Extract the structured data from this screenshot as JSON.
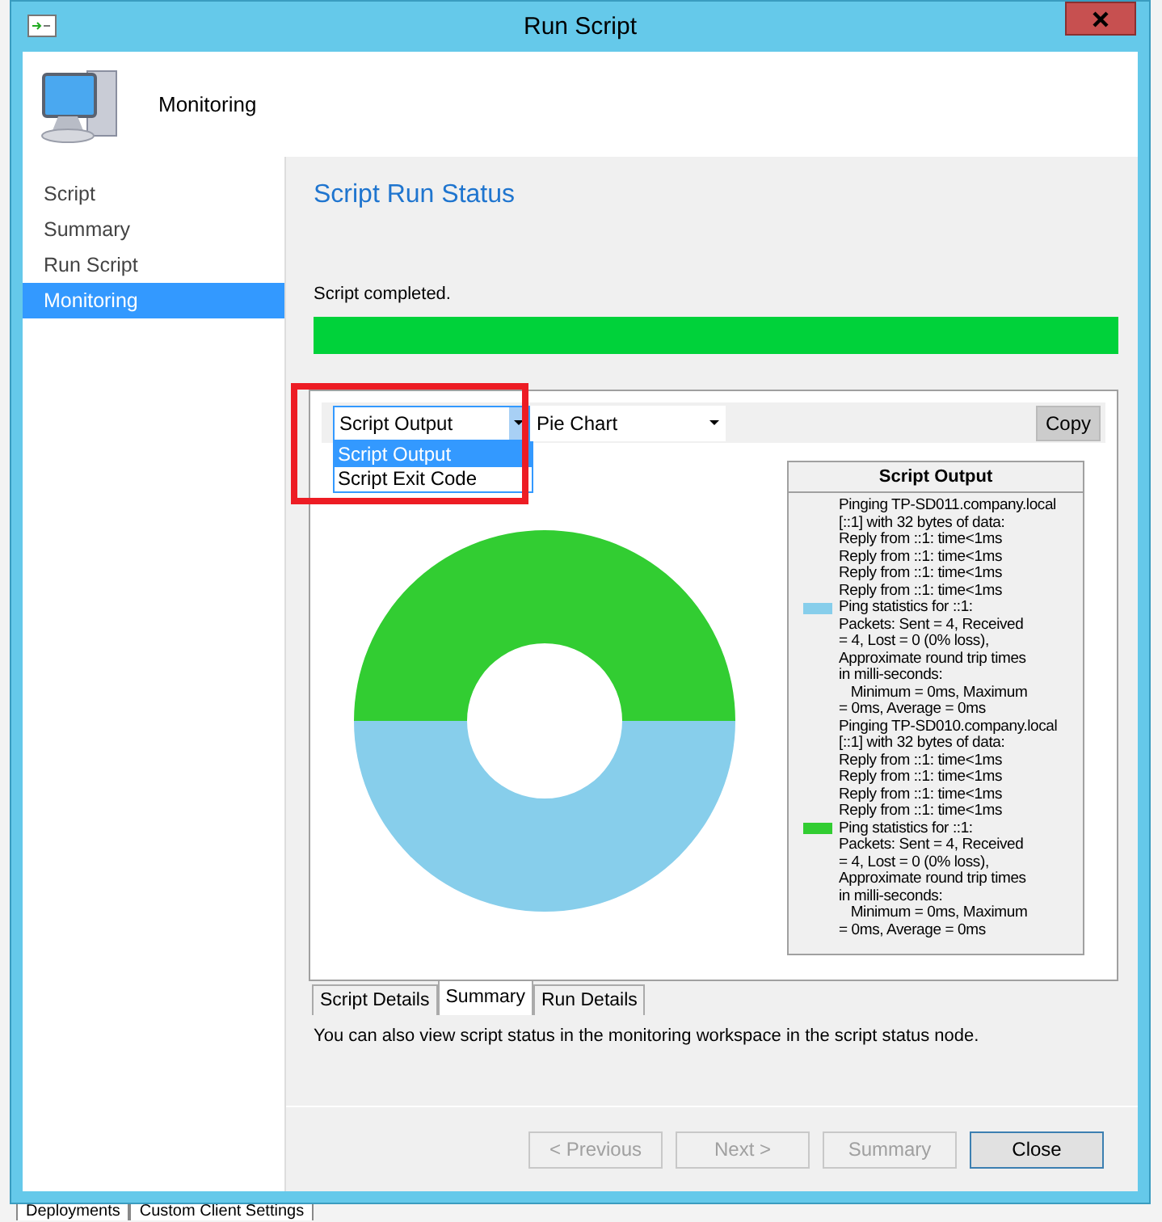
{
  "window": {
    "title": "Run Script",
    "header": "Monitoring"
  },
  "sidebar": {
    "items": [
      {
        "label": "Script",
        "selected": false
      },
      {
        "label": "Summary",
        "selected": false
      },
      {
        "label": "Run Script",
        "selected": false
      },
      {
        "label": "Monitoring",
        "selected": true
      }
    ]
  },
  "page_title": "Script Run Status",
  "status": {
    "text": "Script completed.",
    "level": 1
  },
  "toolbar": {
    "output_dropdown": {
      "value": "Script Output",
      "expanded": true,
      "options": [
        {
          "label": "Script Output",
          "selected": true
        },
        {
          "label": "Script Exit Code",
          "selected": false
        }
      ]
    },
    "chart_dropdown": {
      "value": "Pie Chart"
    },
    "copy_button": "Copy"
  },
  "legend": {
    "title": "Script Output",
    "items": [
      {
        "color": "#87ceeb",
        "lines": [
          "Pinging TP-SD011.company.local",
          "[::1] with 32 bytes of data:",
          "Reply from ::1: time<1ms",
          "Reply from ::1: time<1ms",
          "Reply from ::1: time<1ms",
          "Reply from ::1: time<1ms",
          "Ping statistics for ::1:",
          "Packets: Sent = 4, Received",
          "= 4, Lost = 0 (0% loss),",
          "Approximate round trip times",
          "in milli-seconds:",
          "   Minimum = 0ms, Maximum",
          "= 0ms, Average = 0ms"
        ]
      },
      {
        "color": "#32cd32",
        "lines": [
          "Pinging TP-SD010.company.local",
          "[::1] with 32 bytes of data:",
          "Reply from ::1: time<1ms",
          "Reply from ::1: time<1ms",
          "Reply from ::1: time<1ms",
          "Reply from ::1: time<1ms",
          "Ping statistics for ::1:",
          "Packets: Sent = 4, Received",
          "= 4, Lost = 0 (0% loss),",
          "Approximate round trip times",
          "in milli-seconds:",
          "   Minimum = 0ms, Maximum",
          "= 0ms, Average = 0ms"
        ]
      }
    ]
  },
  "tabs": [
    {
      "label": "Script Details",
      "selected": false
    },
    {
      "label": "Summary",
      "selected": true
    },
    {
      "label": "Run Details",
      "selected": false
    }
  ],
  "note": "You can also view script status in the monitoring workspace in the script status node.",
  "buttons": [
    {
      "label": "< Previous",
      "disabled": true
    },
    {
      "label": "Next >",
      "disabled": true
    },
    {
      "label": "Summary",
      "disabled": true
    },
    {
      "label": "Close",
      "disabled": false
    }
  ],
  "background_tabs": [
    "Deployments",
    "Custom Client Settings"
  ]
}
